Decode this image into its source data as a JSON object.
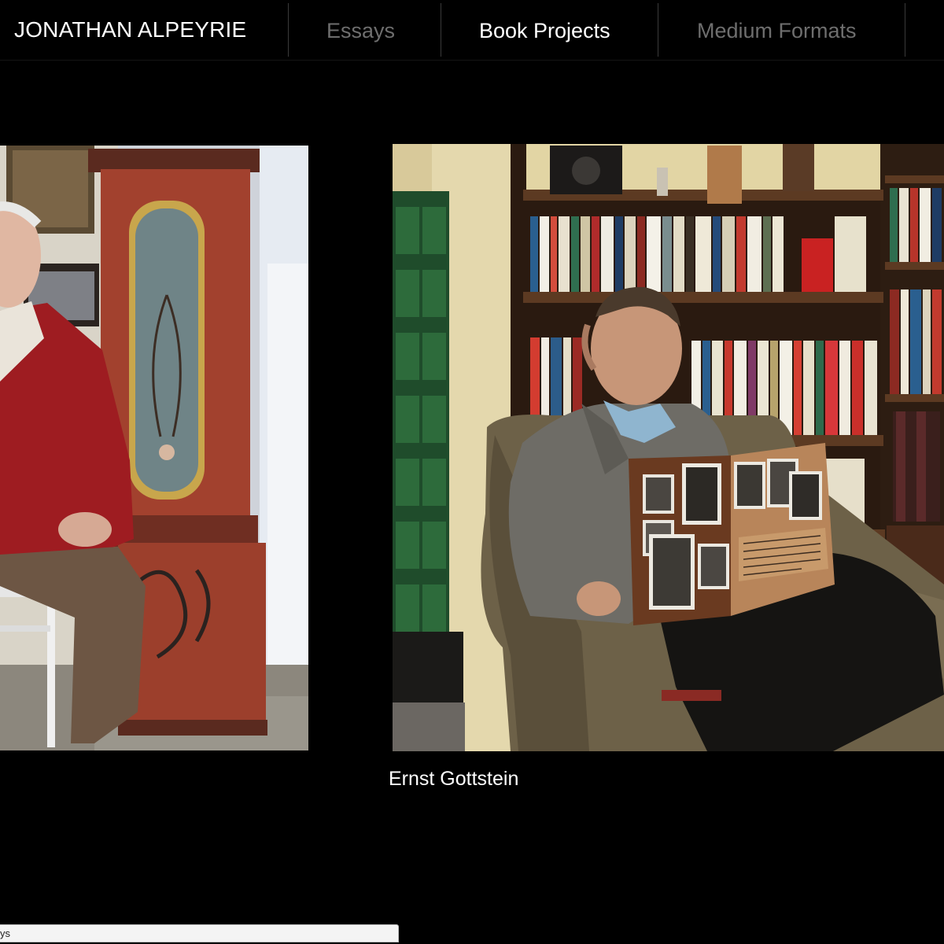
{
  "site": {
    "brand": "JONATHAN ALPEYRIE"
  },
  "nav": {
    "items": [
      {
        "label": "Essays",
        "state": "inactive"
      },
      {
        "label": "Book Projects",
        "state": "active"
      },
      {
        "label": "Medium Formats",
        "state": "inactive"
      }
    ]
  },
  "gallery": {
    "photos": [
      {
        "subject": "elderly man in red cardigan seated beside painted clock",
        "caption": ""
      },
      {
        "subject": "elderly man in armchair holding photo album before bookshelves",
        "caption": "Ernst Gottstein"
      }
    ]
  },
  "status_bar": {
    "text": "ys"
  },
  "colors": {
    "background": "#000000",
    "nav_active": "#ffffff",
    "nav_inactive": "#6e6e6e"
  }
}
